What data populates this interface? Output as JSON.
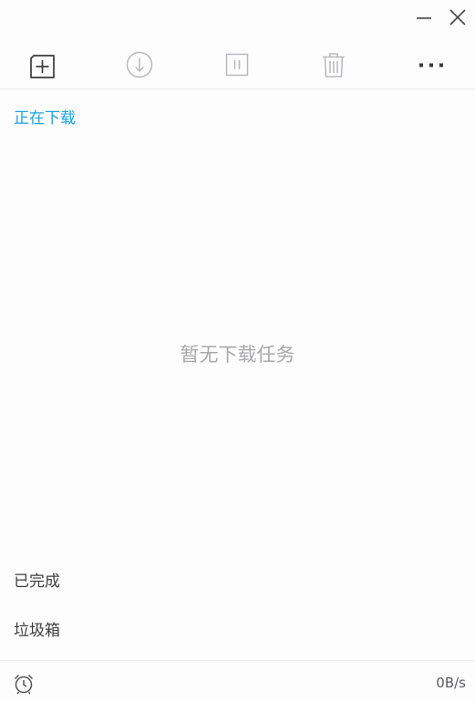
{
  "window": {
    "minimize_icon": "minimize-icon",
    "close_icon": "close-icon"
  },
  "toolbar": {
    "items": [
      {
        "name": "new-task",
        "icon": "add-square-icon",
        "enabled": true
      },
      {
        "name": "start",
        "icon": "download-circle-icon",
        "enabled": false
      },
      {
        "name": "pause",
        "icon": "pause-icon",
        "enabled": false
      },
      {
        "name": "delete",
        "icon": "trash-icon",
        "enabled": false
      },
      {
        "name": "more",
        "icon": "more-dots-icon",
        "enabled": true
      }
    ]
  },
  "nav": {
    "downloading": "正在下载",
    "completed": "已完成",
    "trash": "垃圾箱"
  },
  "main": {
    "empty_message": "暂无下载任务"
  },
  "footer": {
    "alarm_icon": "alarm-clock-icon",
    "speed": "0B/s"
  },
  "colors": {
    "accent": "#19a3e3",
    "text": "#3d3d3d",
    "muted": "#a9a9ad",
    "disabled_icon": "#b9b9bd",
    "divider": "#e9e9ee"
  }
}
